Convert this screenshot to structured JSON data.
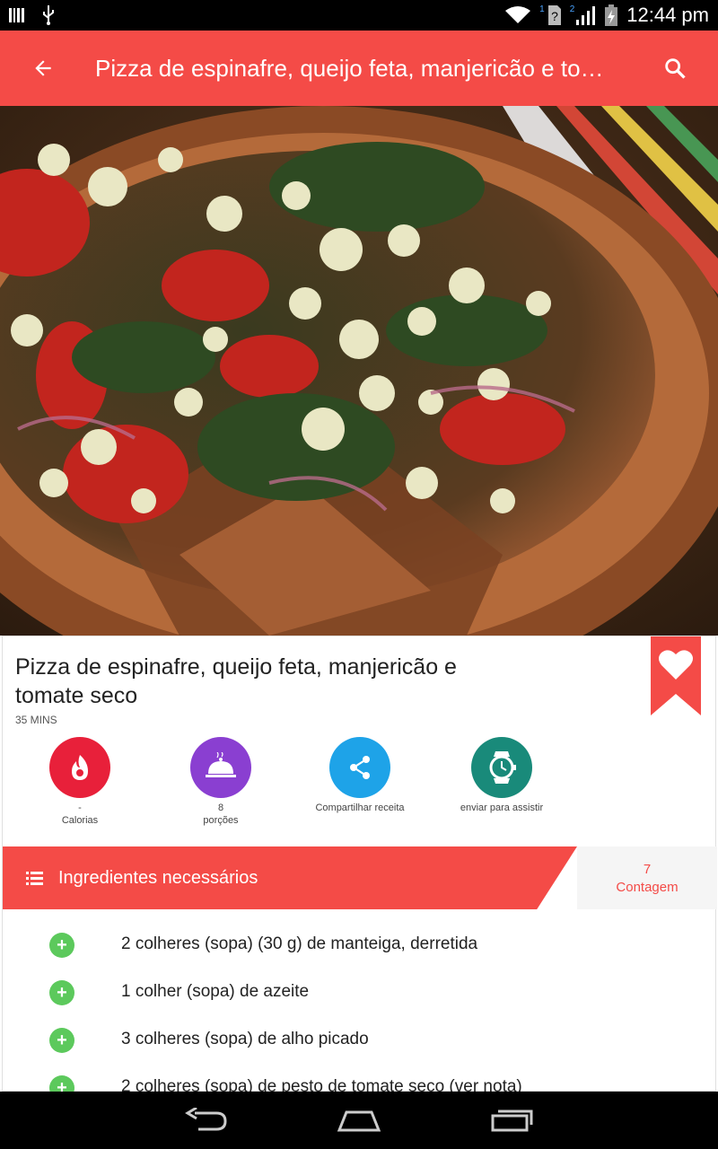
{
  "status_bar": {
    "time": "12:44 pm",
    "sim1_label": "1",
    "sim2_label": "2",
    "icons": [
      "barcode-icon",
      "usb-icon",
      "wifi-icon",
      "no-sim-icon",
      "signal-icon",
      "battery-charging-icon"
    ]
  },
  "app_bar": {
    "title": "Pizza de espinafre, queijo feta, manjericão e to…",
    "back_icon": "arrow-back-icon",
    "search_icon": "search-icon"
  },
  "recipe": {
    "title": "Pizza de espinafre, queijo feta, manjericão e tomate seco",
    "time": "35 MINS"
  },
  "stats": [
    {
      "value": "-",
      "label": "Calorias",
      "icon": "fire-icon",
      "color": "#e8203a"
    },
    {
      "value": "8",
      "label": "porções",
      "icon": "serving-dish-icon",
      "color": "#8a3fd1"
    },
    {
      "value": "",
      "label": "Compartilhar receita",
      "icon": "share-icon",
      "color": "#1ea3e8"
    },
    {
      "value": "",
      "label": "enviar para assistir",
      "icon": "watch-icon",
      "color": "#198a7a"
    }
  ],
  "ingredients_header": {
    "label": "Ingredientes necessários",
    "count": "7",
    "count_label": "Contagem"
  },
  "ingredients": [
    "2 colheres (sopa) (30 g) de manteiga, derretida",
    "1 colher (sopa) de azeite",
    "3 colheres (sopa) de alho picado",
    "2 colheres (sopa) de pesto de tomate seco (ver nota)"
  ],
  "colors": {
    "accent": "#f44b47",
    "add_green": "#5cc95c"
  }
}
